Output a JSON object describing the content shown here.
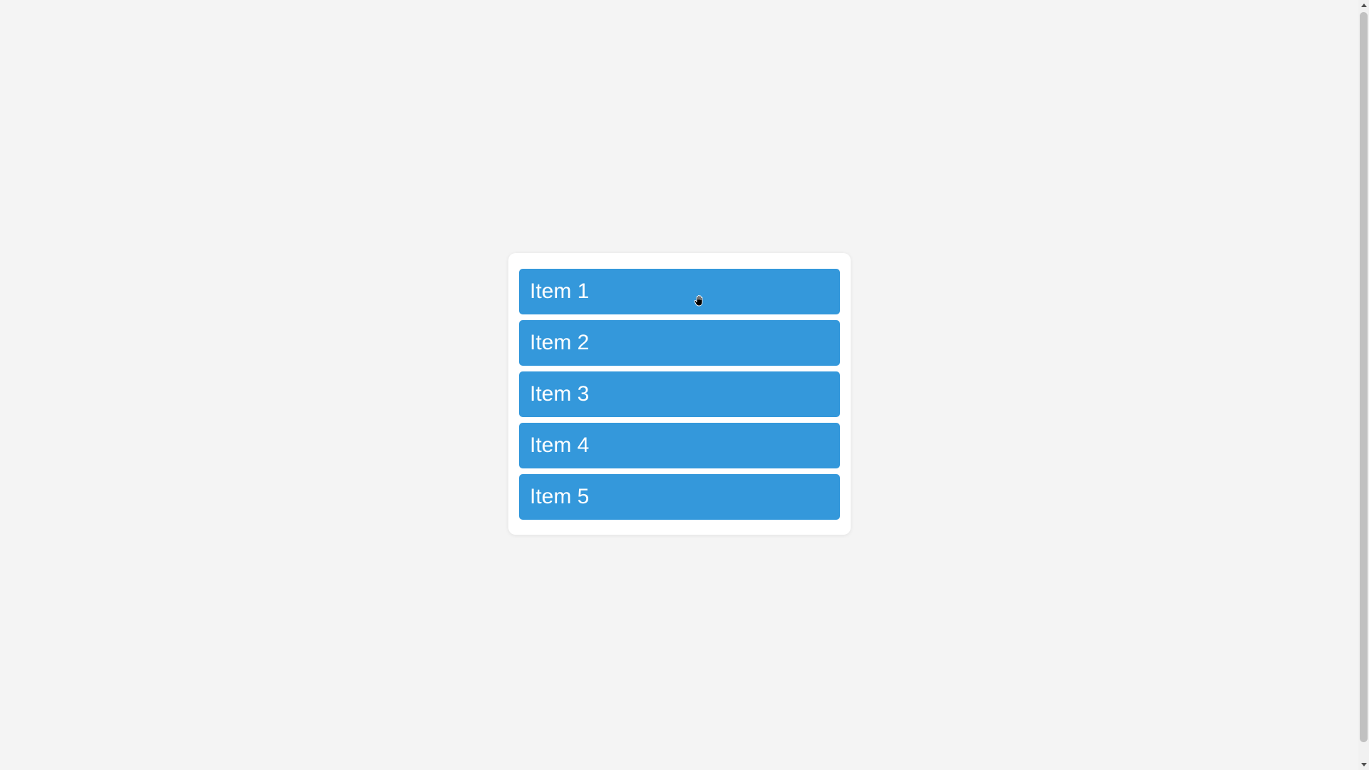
{
  "list": {
    "items": [
      {
        "label": "Item 1"
      },
      {
        "label": "Item 2"
      },
      {
        "label": "Item 3"
      },
      {
        "label": "Item 4"
      },
      {
        "label": "Item 5"
      }
    ]
  },
  "colors": {
    "page_background": "#f4f4f4",
    "card_background": "#ffffff",
    "item_background": "#3498db",
    "item_text": "#ffffff"
  },
  "cursor": {
    "icon": "grab-hand-icon"
  }
}
